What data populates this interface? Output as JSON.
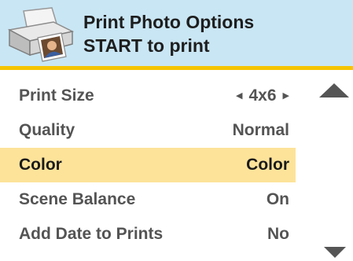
{
  "header": {
    "title_line1": "Print Photo Options",
    "title_line2": "START to print",
    "icon": "printer-with-photo-icon",
    "background_color": "#c9e6f4",
    "accent_color": "#f6c400"
  },
  "menu": {
    "items": [
      {
        "label": "Print Size",
        "value": "4x6",
        "has_arrows": true,
        "selected": false
      },
      {
        "label": "Quality",
        "value": "Normal",
        "has_arrows": false,
        "selected": false
      },
      {
        "label": "Color",
        "value": "Color",
        "has_arrows": false,
        "selected": true
      },
      {
        "label": "Scene Balance",
        "value": "On",
        "has_arrows": false,
        "selected": false
      },
      {
        "label": "Add Date to Prints",
        "value": "No",
        "has_arrows": false,
        "selected": false
      }
    ],
    "selected_color": "#fde39a"
  },
  "scroll": {
    "up_icon": "triangle-up-icon",
    "down_icon": "triangle-down-icon"
  }
}
